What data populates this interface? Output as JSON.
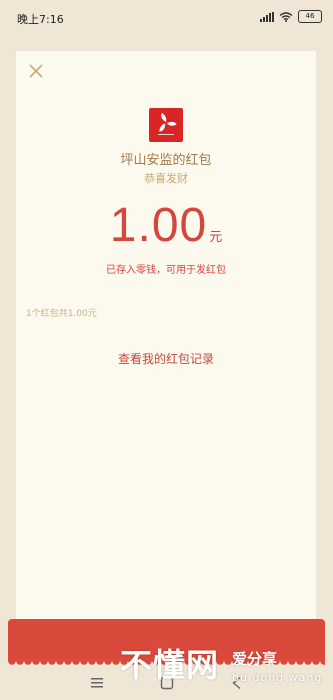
{
  "status_bar": {
    "time": "晚上7:16",
    "battery": "46"
  },
  "card": {
    "sender_name": "坪山安监的红包",
    "greeting": "恭喜发财",
    "amount": "1.00",
    "amount_unit": "元",
    "amount_note": "已存入零钱，可用于发红包",
    "summary": "1个红包共1.00元",
    "records_link": "查看我的红包记录"
  },
  "watermark": {
    "main": "不懂网",
    "side": "爱分享",
    "pinyin": "bu dong wang"
  },
  "colors": {
    "background": "#efe6d6",
    "card": "#fcf9ee",
    "accent_red": "#d4473d",
    "gold_text": "#a27a47",
    "close_icon": "#c9a77c"
  },
  "icons": {
    "close": "close-icon",
    "logo": "logo-icon",
    "signal": "signal-icon",
    "wifi": "wifi-icon",
    "battery": "battery-icon",
    "nav_menu": "menu-icon",
    "nav_home": "home-icon",
    "nav_back": "back-icon"
  }
}
